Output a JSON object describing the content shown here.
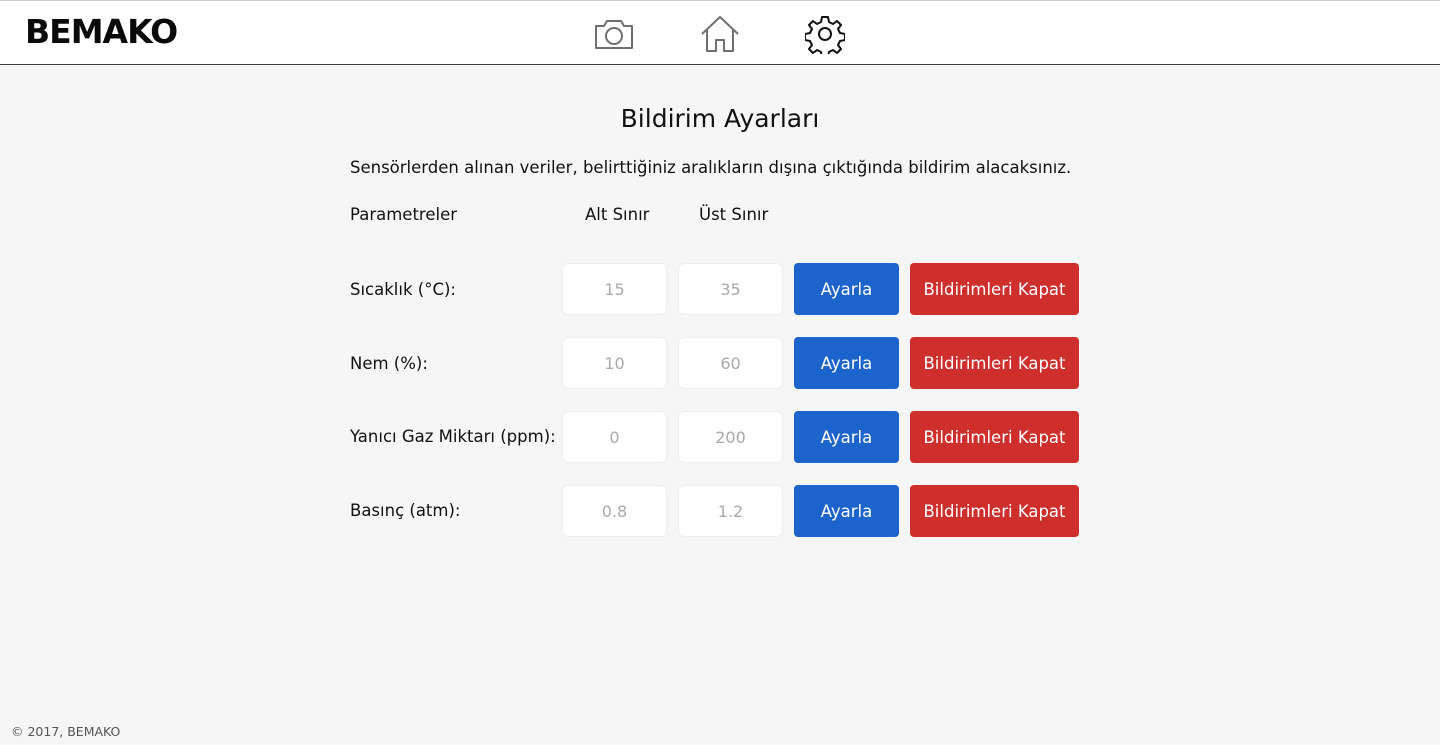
{
  "header": {
    "logo": "BEMAKO",
    "icons": [
      "camera-icon",
      "home-icon",
      "gear-icon"
    ]
  },
  "page": {
    "title": "Bildirim Ayarları",
    "description": "Sensörlerden alınan veriler, belirttiğiniz aralıkların dışına çıktığında bildirim alacaksınız.",
    "columns": {
      "parameters": "Parametreler",
      "lower": "Alt Sınır",
      "upper": "Üst Sınır"
    },
    "rows": [
      {
        "label": "Sıcaklık (°C):",
        "lower_placeholder": "15",
        "upper_placeholder": "35",
        "set_label": "Ayarla",
        "off_label": "Bildirimleri Kapat"
      },
      {
        "label": "Nem (%):",
        "lower_placeholder": "10",
        "upper_placeholder": "60",
        "set_label": "Ayarla",
        "off_label": "Bildirimleri Kapat"
      },
      {
        "label": "Yanıcı Gaz Miktarı (ppm):",
        "lower_placeholder": "0",
        "upper_placeholder": "200",
        "set_label": "Ayarla",
        "off_label": "Bildirimleri Kapat"
      },
      {
        "label": "Basınç (atm):",
        "lower_placeholder": "0.8",
        "upper_placeholder": "1.2",
        "set_label": "Ayarla",
        "off_label": "Bildirimleri Kapat"
      }
    ]
  },
  "footer": {
    "copyright": "© 2017, BEMAKO"
  },
  "colors": {
    "set_button": "#1c64cc",
    "off_button": "#cf2f2c",
    "background": "#f6f6f6"
  }
}
